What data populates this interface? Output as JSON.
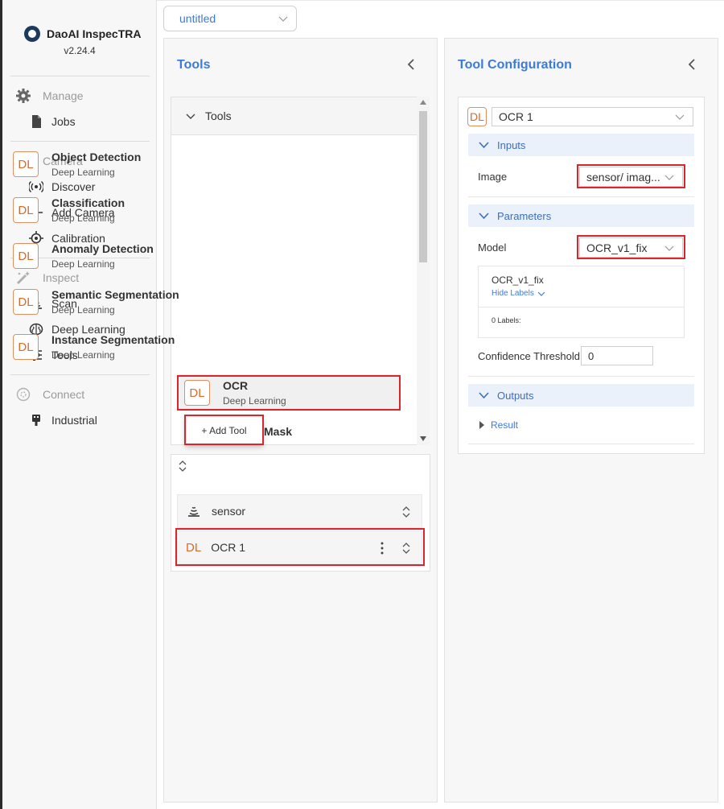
{
  "app": {
    "name": "DaoAI InspecTRA",
    "version": "v2.24.4"
  },
  "sidebar": {
    "sections": [
      {
        "label": "Manage",
        "items": [
          {
            "label": "Jobs"
          }
        ]
      },
      {
        "label": "Camera",
        "items": [
          {
            "label": "Discover"
          },
          {
            "label": "Add Camera"
          },
          {
            "label": "Calibration"
          }
        ]
      },
      {
        "label": "Inspect",
        "items": [
          {
            "label": "Scan"
          },
          {
            "label": "Deep Learning"
          },
          {
            "label": "Tools"
          }
        ]
      },
      {
        "label": "Connect",
        "items": [
          {
            "label": "Industrial"
          }
        ]
      }
    ]
  },
  "project_select": {
    "value": "untitled"
  },
  "tools_panel": {
    "title": "Tools",
    "group_label": "Tools",
    "items": [
      {
        "badge": "DL",
        "name": "Object Detection",
        "category": "Deep Learning"
      },
      {
        "badge": "DL",
        "name": "Classification",
        "category": "Deep Learning"
      },
      {
        "badge": "DL",
        "name": "Anomaly Detection",
        "category": "Deep Learning"
      },
      {
        "badge": "DL",
        "name": "Semantic Segmentation",
        "category": "Deep Learning"
      },
      {
        "badge": "DL",
        "name": "Instance Segmentation",
        "category": "Deep Learning"
      },
      {
        "badge": "DL",
        "name": "OCR",
        "category": "Deep Learning"
      },
      {
        "name_partial": "Mask"
      }
    ],
    "add_tool_label": "+ Add Tool"
  },
  "pipeline": {
    "rows": [
      {
        "label": "sensor"
      },
      {
        "badge": "DL",
        "label": "OCR 1"
      }
    ]
  },
  "config_panel": {
    "title": "Tool Configuration",
    "tool_badge": "DL",
    "tool_select": "OCR 1",
    "inputs": {
      "header": "Inputs",
      "image_label": "Image",
      "image_value": "sensor/ imag..."
    },
    "parameters": {
      "header": "Parameters",
      "model_label": "Model",
      "model_value": "OCR_v1_fix",
      "model_card_title": "OCR_v1_fix",
      "hide_labels": "Hide Labels",
      "labels_count": "0 Labels:",
      "confidence_label": "Confidence Threshold",
      "confidence_value": "0"
    },
    "outputs": {
      "header": "Outputs",
      "result_label": "Result"
    }
  },
  "colors": {
    "accent": "#3d7bd9",
    "dl_orange": "#d96a2b",
    "highlight_red": "#d9262c"
  }
}
